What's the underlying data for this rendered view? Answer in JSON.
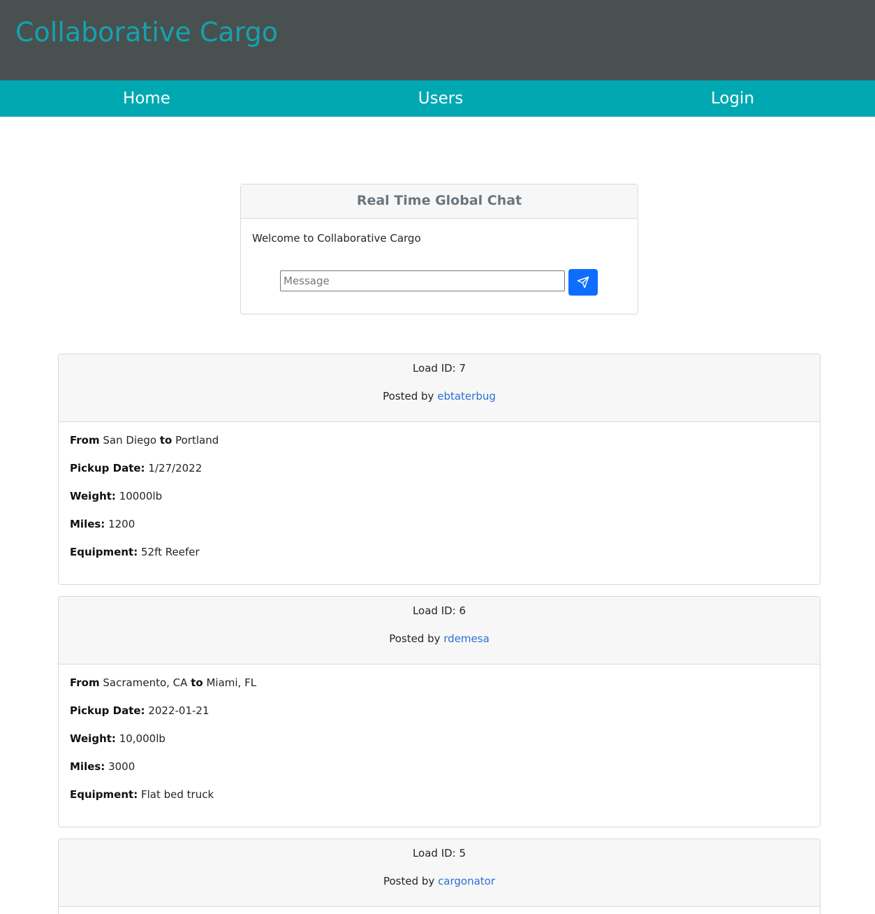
{
  "header": {
    "title": "Collaborative Cargo"
  },
  "nav": {
    "home": "Home",
    "users": "Users",
    "login": "Login"
  },
  "chat": {
    "title": "Real Time Global Chat",
    "welcome": "Welcome to Collaborative Cargo",
    "input_placeholder": "Message",
    "input_value": "",
    "send_icon": "send-icon"
  },
  "labels": {
    "load_id": "Load ID:",
    "posted_by": "Posted by",
    "from": "From",
    "to": "to",
    "pickup_date": "Pickup Date:",
    "weight": "Weight:",
    "miles": "Miles:",
    "equipment": "Equipment:"
  },
  "loads": [
    {
      "id": "7",
      "user": "ebtaterbug",
      "from": "San Diego",
      "to": "Portland",
      "pickup_date": "1/27/2022",
      "weight": "10000lb",
      "miles": "1200",
      "equipment": "52ft Reefer"
    },
    {
      "id": "6",
      "user": "rdemesa",
      "from": "Sacramento, CA",
      "to": "Miami, FL",
      "pickup_date": "2022-01-21",
      "weight": "10,000lb",
      "miles": "3000",
      "equipment": "Flat bed truck"
    },
    {
      "id": "5",
      "user": "cargonator"
    }
  ],
  "colors": {
    "header_bg": "#495050",
    "title": "#14a3ad",
    "nav_bg": "#00a9b2",
    "button": "#0d6efd",
    "link": "#2a6fd6"
  }
}
